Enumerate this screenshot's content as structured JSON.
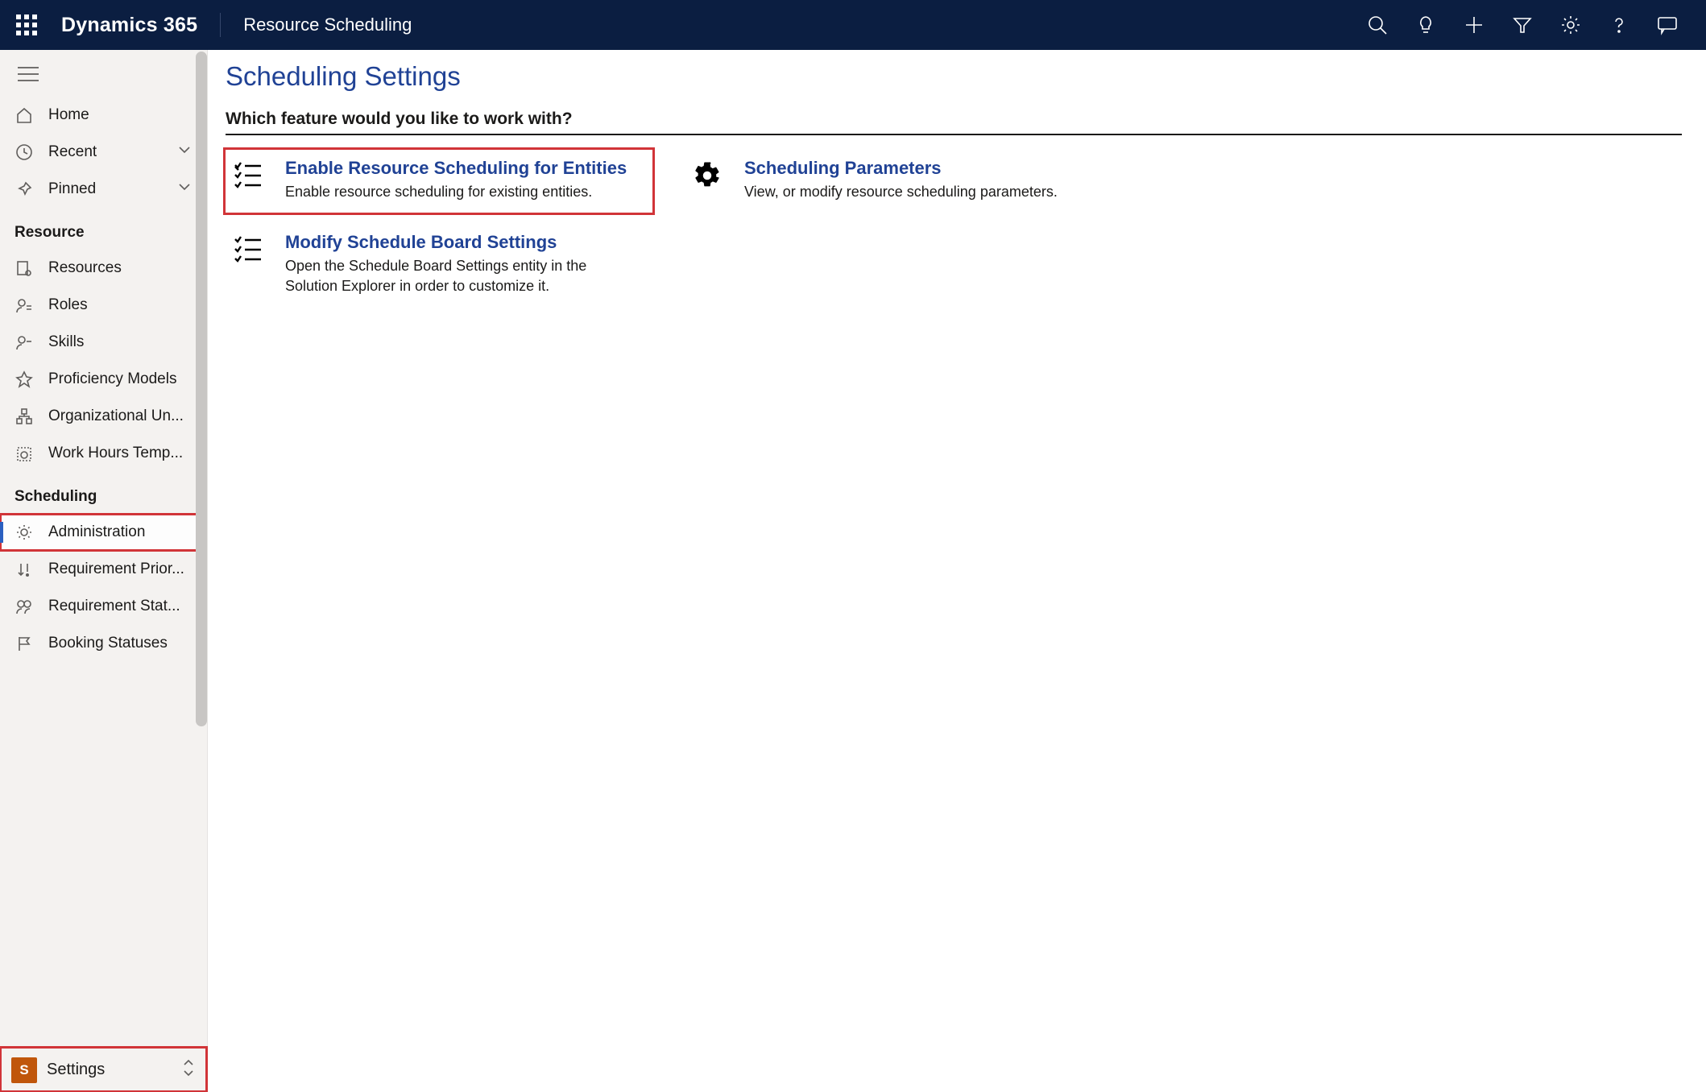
{
  "header": {
    "brand": "Dynamics 365",
    "app_name": "Resource Scheduling"
  },
  "sidebar": {
    "top": [
      {
        "icon": "home",
        "label": "Home",
        "expandable": false
      },
      {
        "icon": "clock",
        "label": "Recent",
        "expandable": true
      },
      {
        "icon": "pin",
        "label": "Pinned",
        "expandable": true
      }
    ],
    "sections": [
      {
        "title": "Resource",
        "items": [
          {
            "icon": "resource",
            "label": "Resources"
          },
          {
            "icon": "roles",
            "label": "Roles"
          },
          {
            "icon": "skills",
            "label": "Skills"
          },
          {
            "icon": "star",
            "label": "Proficiency Models"
          },
          {
            "icon": "org",
            "label": "Organizational Un..."
          },
          {
            "icon": "calendar",
            "label": "Work Hours Temp..."
          }
        ]
      },
      {
        "title": "Scheduling",
        "items": [
          {
            "icon": "gear",
            "label": "Administration",
            "selected": true,
            "highlight": true
          },
          {
            "icon": "priority",
            "label": "Requirement Prior..."
          },
          {
            "icon": "status",
            "label": "Requirement Stat..."
          },
          {
            "icon": "flag",
            "label": "Booking Statuses"
          }
        ]
      }
    ]
  },
  "area_switcher": {
    "badge_letter": "S",
    "label": "Settings",
    "highlight": true
  },
  "main": {
    "title": "Scheduling Settings",
    "prompt": "Which feature would you like to work with?",
    "tiles_left": [
      {
        "icon": "checklist",
        "title": "Enable Resource Scheduling for Entities",
        "desc": "Enable resource scheduling for existing entities.",
        "highlight": true
      },
      {
        "icon": "checklist",
        "title": "Modify Schedule Board Settings",
        "desc": "Open the Schedule Board Settings entity in the Solution Explorer in order to customize it."
      }
    ],
    "tiles_right": [
      {
        "icon": "gear-solid",
        "title": "Scheduling Parameters",
        "desc": "View, or modify resource scheduling parameters."
      }
    ]
  }
}
